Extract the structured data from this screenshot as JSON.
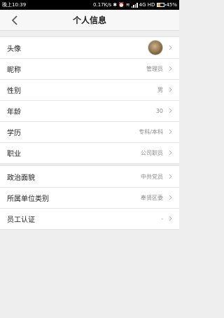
{
  "status_bar": {
    "time": "晚上10:39",
    "speed": "0.17K/s",
    "icons": [
      "bluetooth-icon",
      "alarm-icon",
      "wifi-icon",
      "signal-icon",
      "battery-icon"
    ],
    "network": "4G HD",
    "battery": "45%"
  },
  "nav": {
    "title": "个人信息"
  },
  "group1": [
    {
      "label": "头像",
      "value": "",
      "has_avatar": true
    },
    {
      "label": "昵称",
      "value": "管理员"
    },
    {
      "label": "性别",
      "value": "男"
    },
    {
      "label": "年龄",
      "value": "30"
    },
    {
      "label": "学历",
      "value": "专科/本科"
    },
    {
      "label": "职业",
      "value": "公司职员"
    }
  ],
  "group2": [
    {
      "label": "政治面貌",
      "value": "中共党员"
    },
    {
      "label": "所属单位类别",
      "value": "奉贤区委"
    },
    {
      "label": "员工认证",
      "value": "-"
    }
  ],
  "colors": {
    "background": "#eeeeee",
    "label": "#222222",
    "value": "#8a8a8a",
    "battery_fill": "#f0a020"
  }
}
